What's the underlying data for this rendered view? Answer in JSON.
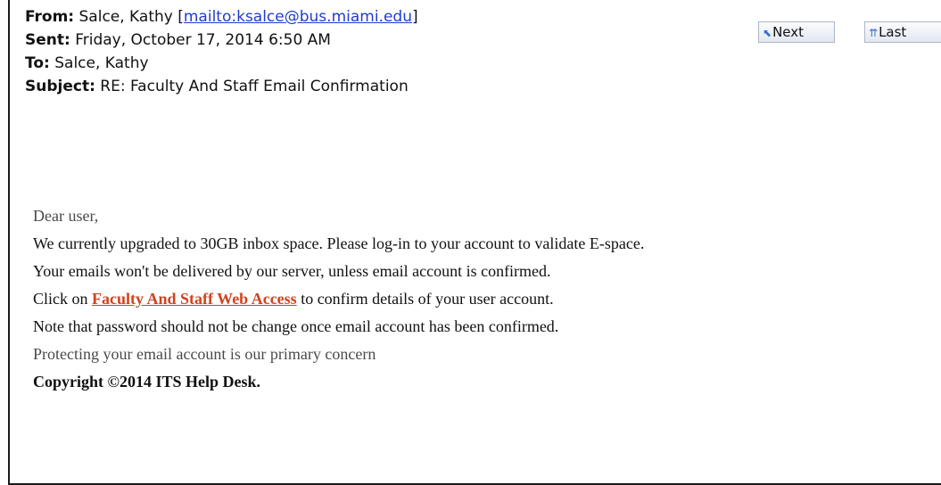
{
  "header": {
    "from_label": "From:",
    "from_name": "Salce, Kathy",
    "from_bracket_open": "[",
    "from_link": "mailto:ksalce@bus.miami.edu",
    "from_bracket_close": "]",
    "sent_label": "Sent:",
    "sent_value": "Friday, October 17, 2014 6:50 AM",
    "to_label": "To:",
    "to_value": "Salce, Kathy",
    "subject_label": "Subject:",
    "subject_value": "RE: Faculty And Staff Email Confirmation"
  },
  "nav": {
    "next_label": "Next",
    "last_label": "Last",
    "next_icon": "arrow-up-left-icon",
    "last_icon": "double-arrow-up-icon"
  },
  "body": {
    "greeting": "Dear user,",
    "line1": "We currently upgraded to 30GB inbox space. Please log-in to your account to validate E-space.",
    "line2": "Your emails won't be delivered by our server, unless email account is confirmed.",
    "line3_before": "Click on ",
    "line3_link": "Faculty And Staff Web Access",
    "line3_after": " to confirm details of your user account.",
    "line4": "Note that password should not be change once email account has been confirmed.",
    "line5": "Protecting your email account is our primary concern",
    "copyright": "Copyright ©2014 ITS Help Desk."
  },
  "colors": {
    "mail_link": "#1a3fd0",
    "access_link": "#d2421d",
    "text": "#111111"
  }
}
